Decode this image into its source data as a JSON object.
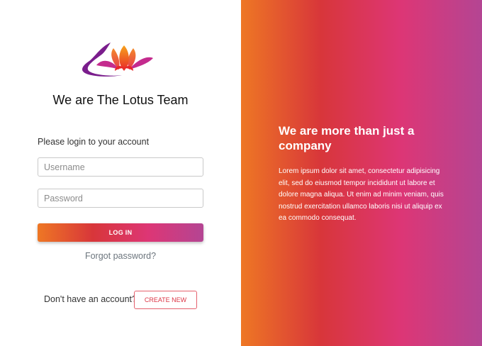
{
  "brand": {
    "logo_icon": "lotus-flower-icon",
    "team_title": "We are The Lotus Team"
  },
  "login_form": {
    "prompt": "Please login to your account",
    "username_placeholder": "Username",
    "password_placeholder": "Password",
    "login_label": "LOG IN",
    "forgot_password": "Forgot password?"
  },
  "signup": {
    "prompt": "Don't have an account?",
    "create_new_label": "CREATE NEW"
  },
  "promo": {
    "tagline": "We are more than just a company",
    "description": "Lorem ipsum dolor sit amet, consectetur adipisicing elit, sed do eiusmod tempor incididunt ut labore et dolore magna aliqua. Ut enim ad minim veniam, quis nostrud exercitation ullamco laboris nisi ut aliquip ex ea commodo consequat."
  },
  "colors": {
    "gradient": [
      "#ee7724",
      "#d8363a",
      "#dd3675",
      "#b44593"
    ],
    "create_new_border": "#e4606d"
  }
}
